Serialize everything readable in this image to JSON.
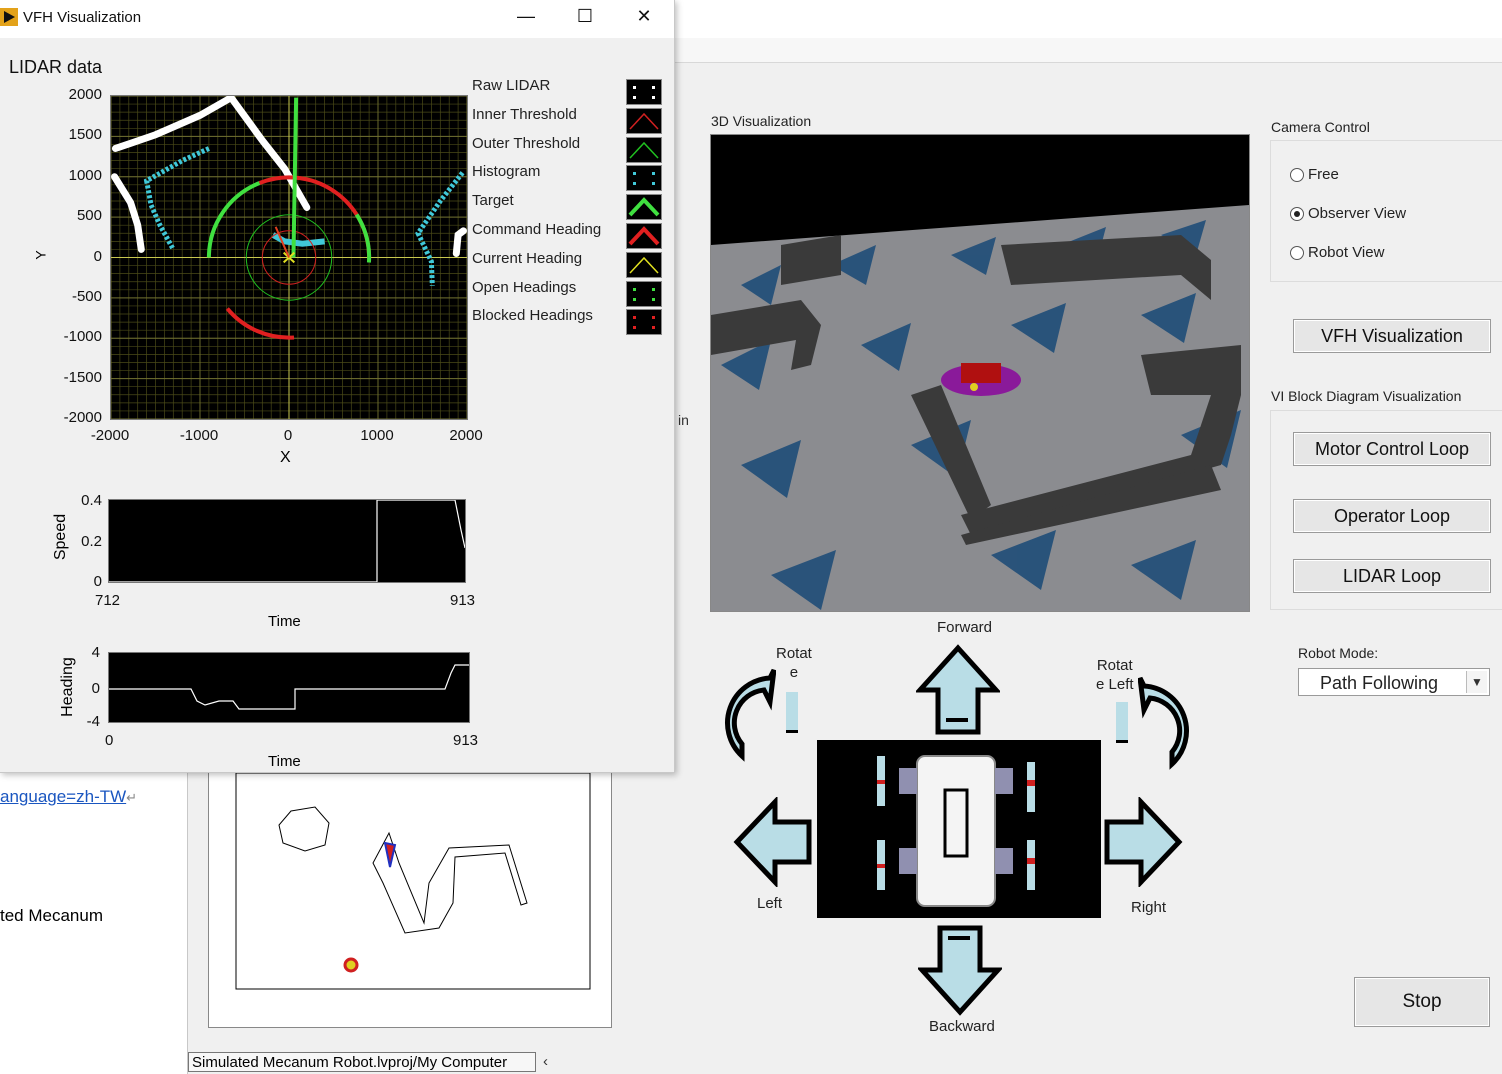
{
  "window": {
    "title": "VFH Visualization",
    "min": "—",
    "max": "☐",
    "close": "✕"
  },
  "lidar_graph": {
    "title": "LIDAR data",
    "xlabel": "X",
    "ylabel": "Y",
    "x_ticks": [
      "-2000",
      "-1000",
      "0",
      "1000",
      "2000"
    ],
    "y_ticks": [
      "2000",
      "1500",
      "1000",
      "500",
      "0",
      "-500",
      "-1000",
      "-1500",
      "-2000"
    ],
    "legend": [
      {
        "label": "Raw LIDAR",
        "color": "#ffffff",
        "icon": "points-icon"
      },
      {
        "label": "Inner Threshold",
        "color": "#d02020",
        "icon": "line-icon"
      },
      {
        "label": "Outer Threshold",
        "color": "#20c020",
        "icon": "line-icon"
      },
      {
        "label": "Histogram",
        "color": "#40c8d8",
        "icon": "points-icon"
      },
      {
        "label": "Target",
        "color": "#40e040",
        "icon": "thick-line-icon"
      },
      {
        "label": "Command Heading",
        "color": "#e02020",
        "icon": "thick-line-icon"
      },
      {
        "label": "Current Heading",
        "color": "#e0e020",
        "icon": "line-icon"
      },
      {
        "label": "Open Headings",
        "color": "#40e040",
        "icon": "points-icon"
      },
      {
        "label": "Blocked Headings",
        "color": "#e02020",
        "icon": "points-icon"
      }
    ]
  },
  "speed_graph": {
    "ylabel": "Speed",
    "xlabel": "Time",
    "y_ticks": [
      "0.4",
      "0.2",
      "0"
    ],
    "x_ticks": [
      "712",
      "913"
    ]
  },
  "heading_graph": {
    "ylabel": "Heading",
    "xlabel": "Time",
    "y_ticks": [
      "4",
      "0",
      "-4"
    ],
    "x_ticks": [
      "0",
      "913"
    ]
  },
  "background_left": {
    "link_text": "anguage=zh-TW",
    "link_mark": "↵",
    "text": "ted Mecanum"
  },
  "main": {
    "visualization_label": "3D Visualization",
    "camera_control": {
      "title": "Camera Control",
      "options": [
        {
          "label": "Free",
          "selected": false
        },
        {
          "label": "Observer View",
          "selected": true
        },
        {
          "label": "Robot View",
          "selected": false
        }
      ]
    },
    "vfh_button": "VFH Visualization",
    "block_diagram_label": "VI Block Diagram Visualization",
    "loop_buttons": [
      "Motor Control Loop",
      "Operator Loop",
      "LIDAR Loop"
    ],
    "robot_mode_label": "Robot Mode:",
    "robot_mode_value": "Path Following",
    "stop_button": "Stop",
    "controls": {
      "forward": "Forward",
      "backward": "Backward",
      "left": "Left",
      "right": "Right",
      "rotate": "Rotat\ne",
      "rotate_left": "Rotat\ne Left"
    },
    "status_path": "Simulated Mecanum Robot.lvproj/My Computer",
    "peek_in": "in"
  }
}
